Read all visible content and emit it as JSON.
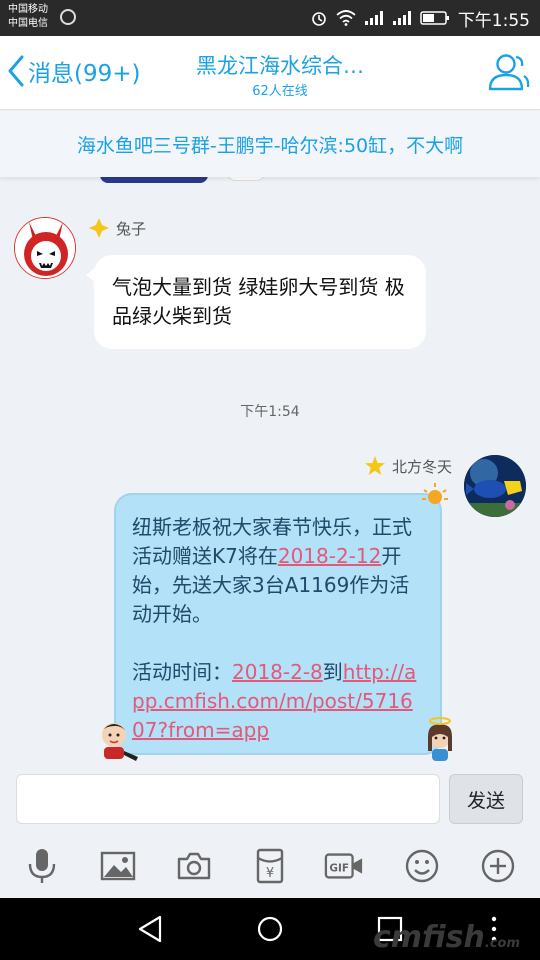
{
  "status_bar": {
    "carrier_1": "中国移动",
    "carrier_2": "中国电信",
    "time": "下午1:55",
    "icons": [
      "alarm-icon",
      "wifi-icon",
      "signal-icon",
      "battery-icon"
    ]
  },
  "header": {
    "back_label": "消息(99+)",
    "title": "黑龙江海水综合…",
    "subtitle": "62人在线",
    "accent_color": "#1aa1e6"
  },
  "notice": {
    "text": "海水鱼吧三号群-王鹏宇-哈尔滨:50缸，不大啊"
  },
  "messages": [
    {
      "sender": "兔子",
      "side": "left",
      "text": "气泡大量到货 绿娃卵大号到货 极品绿火柴到货"
    },
    {
      "timestamp": "下午1:54"
    },
    {
      "sender": "北方冬天",
      "side": "right",
      "line_1": "纽斯老板祝大家春节快乐，正式活动赠送K7将在",
      "date_1": "2018-2-12",
      "line_2": "开始，先送大家3台A1169作为活动开始。",
      "time_label": "活动时间：",
      "date_2": "2018-2-8",
      "to": "到",
      "url": "http://app.cmfish.com/m/post/571607?from=app"
    }
  ],
  "input": {
    "placeholder": "",
    "send_label": "发送"
  },
  "toolbar": [
    "voice-icon",
    "image-icon",
    "camera-icon",
    "red-packet-icon",
    "gif-icon",
    "emoji-icon",
    "plus-icon"
  ],
  "watermark": {
    "text": "cmfish",
    "suffix": ".com"
  }
}
